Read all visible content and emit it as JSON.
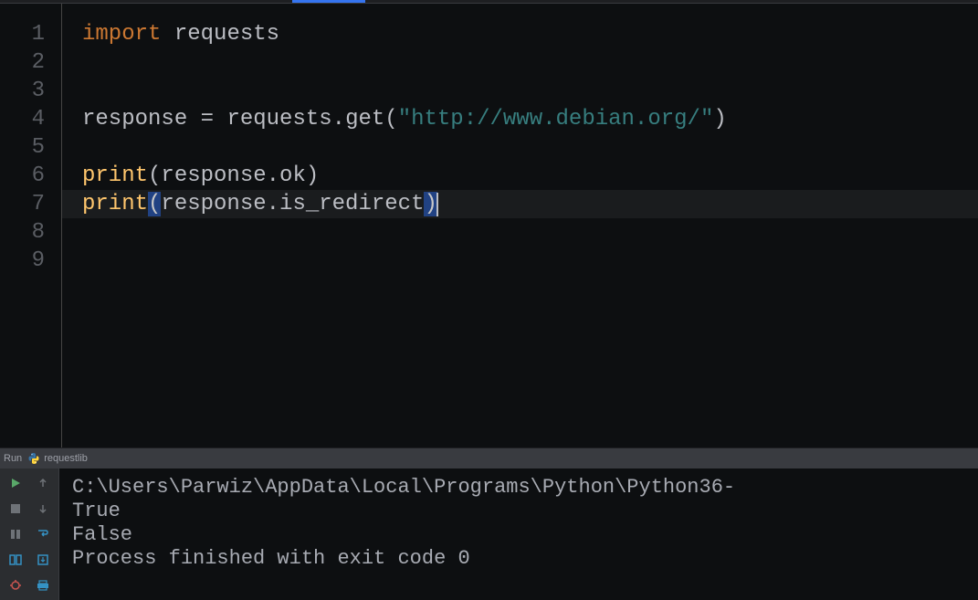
{
  "editor": {
    "line_numbers": [
      "1",
      "2",
      "3",
      "4",
      "5",
      "6",
      "7",
      "8",
      "9"
    ],
    "lines": {
      "l1": {
        "kw": "import",
        "sp": " ",
        "mod": "requests"
      },
      "l4": {
        "var": "response",
        "eq": " = ",
        "obj": "requests",
        "dot": ".",
        "meth": "get",
        "lp": "(",
        "str": "\"http://www.debian.org/\"",
        "rp": ")"
      },
      "l6": {
        "fn": "print",
        "lp": "(",
        "arg1": "response",
        "dot": ".",
        "arg2": "ok",
        "rp": ")"
      },
      "l7": {
        "fn": "print",
        "lp": "(",
        "arg1": "response",
        "dot": ".",
        "arg2": "is_redirect",
        "rp": ")"
      }
    },
    "current_line": 7
  },
  "run": {
    "header_label": "Run",
    "config_name": "requestlib",
    "output": {
      "line1": "C:\\Users\\Parwiz\\AppData\\Local\\Programs\\Python\\Python36-",
      "line2": "True",
      "line3": "False",
      "line4": "",
      "line5": "Process finished with exit code 0"
    }
  }
}
